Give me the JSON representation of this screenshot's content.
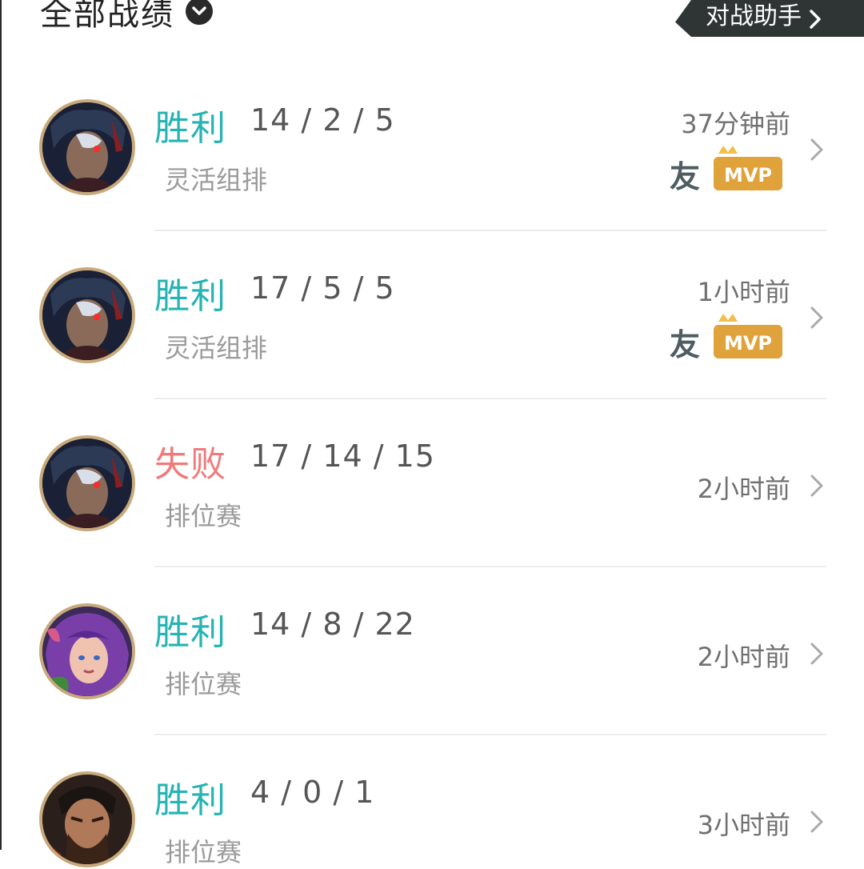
{
  "header": {
    "title": "全部战绩",
    "assistant_label": "对战助手"
  },
  "matches": [
    {
      "result": "胜利",
      "outcome": "win",
      "kda": "14 / 2 / 5",
      "mode": "灵活组排",
      "time": "37分钟前",
      "friend_badge": "友",
      "mvp_badge": "MVP",
      "hero": "dark-hero"
    },
    {
      "result": "胜利",
      "outcome": "win",
      "kda": "17 / 5 / 5",
      "mode": "灵活组排",
      "time": "1小时前",
      "friend_badge": "友",
      "mvp_badge": "MVP",
      "hero": "dark-hero"
    },
    {
      "result": "失败",
      "outcome": "lose",
      "kda": "17 / 14 / 15",
      "mode": "排位赛",
      "time": "2小时前",
      "hero": "dark-hero"
    },
    {
      "result": "胜利",
      "outcome": "win",
      "kda": "14 / 8 / 22",
      "mode": "排位赛",
      "time": "2小时前",
      "hero": "purple-hair-hero"
    },
    {
      "result": "胜利",
      "outcome": "win",
      "kda": "4 / 0 / 1",
      "mode": "排位赛",
      "time": "3小时前",
      "hero": "bearded-hero"
    }
  ],
  "colors": {
    "win": "#25b3b3",
    "lose": "#f07a7a",
    "avatar_border": "#c8a97c",
    "mvp": "#e0a23a",
    "header_button": "#2f3534"
  }
}
